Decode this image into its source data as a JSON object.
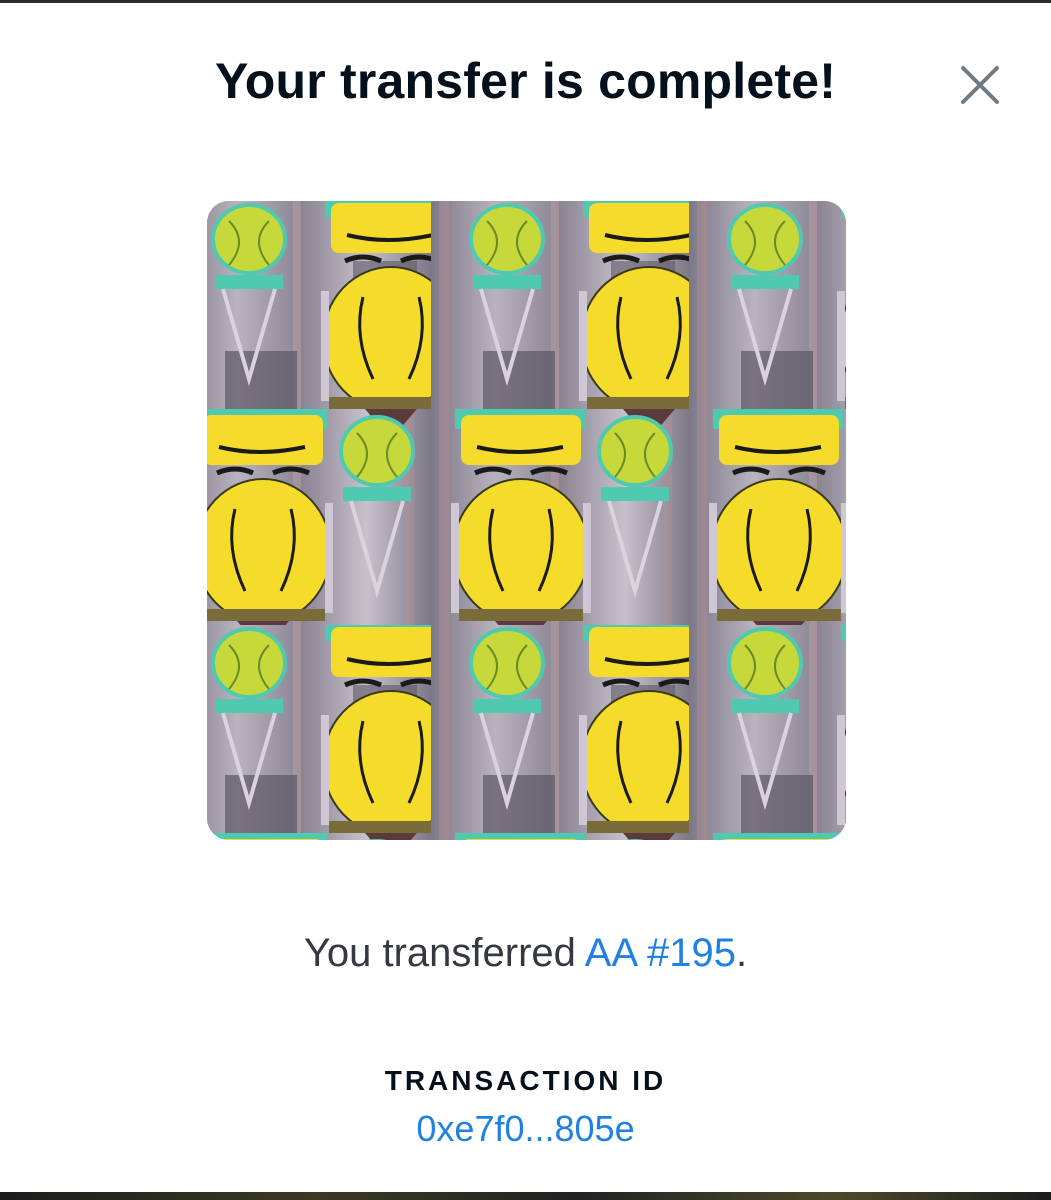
{
  "modal": {
    "title": "Your transfer is complete!",
    "close_icon": "close-icon"
  },
  "nft": {
    "image_description_icon": "nft-artwork-image",
    "colors": {
      "background": "#8d8896",
      "yellow": "#f5dc2a",
      "teal": "#4fc9b0",
      "grey": "#9c96a3"
    }
  },
  "message": {
    "prefix": "You transferred ",
    "item_name": "AA #195",
    "suffix": "."
  },
  "transaction": {
    "label": "TRANSACTION ID",
    "id": "0xe7f0...805e"
  },
  "colors": {
    "title": "#04111d",
    "link": "#2081e2",
    "body_text": "#353840",
    "close_icon": "#707a83"
  }
}
